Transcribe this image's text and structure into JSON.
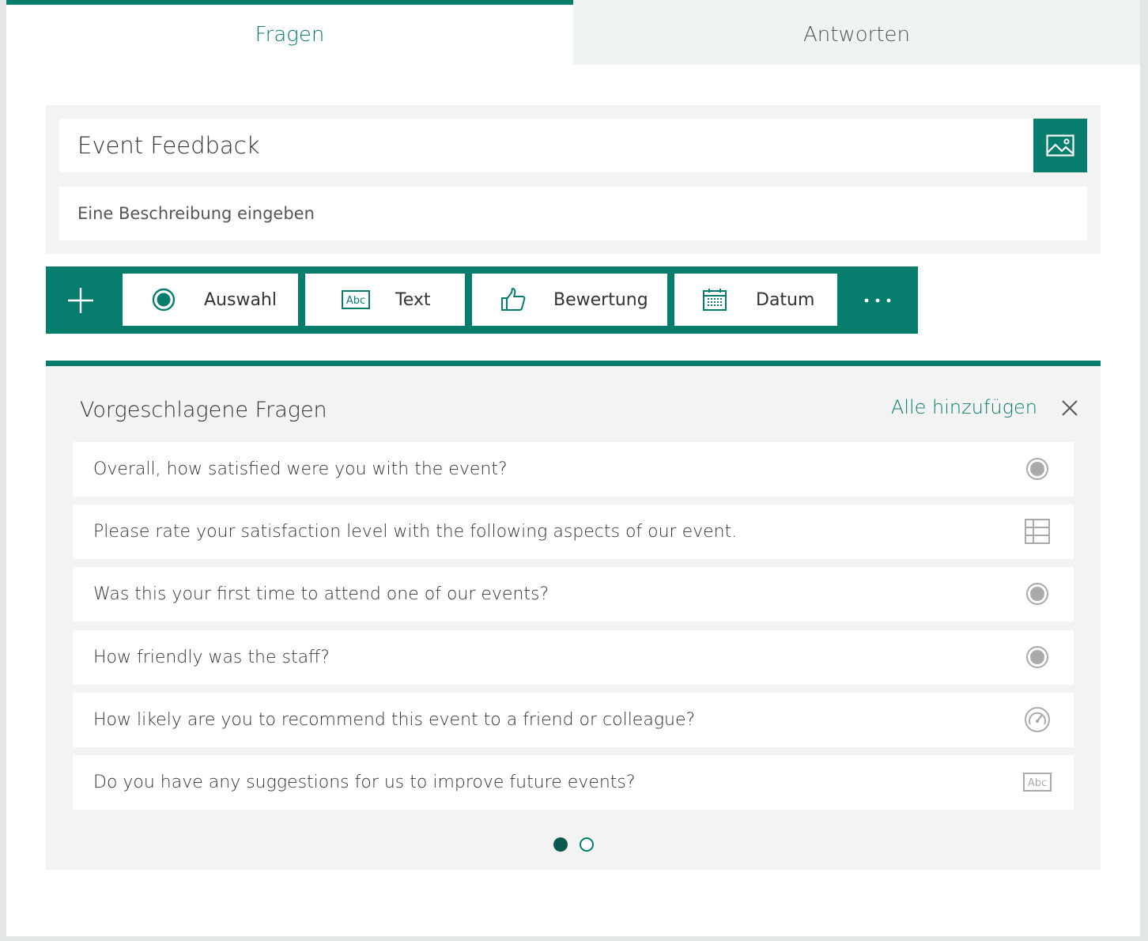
{
  "tabs": {
    "questions": "Fragen",
    "responses": "Antworten"
  },
  "form": {
    "title": "Event Feedback",
    "description_placeholder": "Eine Beschreibung eingeben"
  },
  "toolbar": {
    "choice": "Auswahl",
    "text": "Text",
    "rating": "Bewertung",
    "date": "Datum"
  },
  "suggestions": {
    "title": "Vorgeschlagene Fragen",
    "add_all": "Alle hinzufügen",
    "questions": [
      {
        "text": "Overall, how satisfied were you with the event?",
        "icon": "choice-icon"
      },
      {
        "text": "Please rate your satisfaction level with the following aspects of our event.",
        "icon": "likert-grid-icon"
      },
      {
        "text": "Was this your first time to attend one of our events?",
        "icon": "choice-icon"
      },
      {
        "text": "How friendly was the staff?",
        "icon": "choice-icon"
      },
      {
        "text": "How likely are you to recommend this event to a friend or colleague?",
        "icon": "nps-gauge-icon"
      },
      {
        "text": "Do you have any suggestions for us to improve future events?",
        "icon": "text-abc-icon"
      }
    ],
    "pager": {
      "current": 1,
      "total": 2
    }
  },
  "colors": {
    "accent": "#077d6e",
    "panel": "#f3f3f3",
    "tab_inactive": "#eef4f4"
  }
}
